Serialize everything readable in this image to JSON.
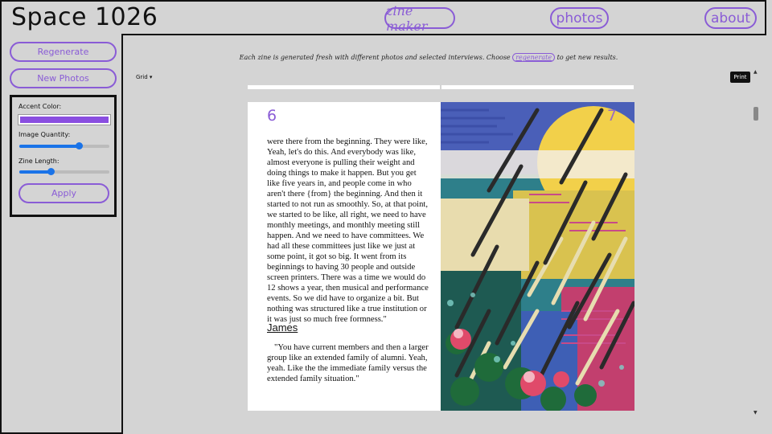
{
  "header": {
    "site_title": "Space 1026",
    "nav": [
      {
        "label": "zine maker"
      },
      {
        "label": "photos"
      },
      {
        "label": "about"
      }
    ]
  },
  "sidebar": {
    "regenerate_label": "Regenerate",
    "new_photos_label": "New Photos",
    "controls": {
      "accent_label": "Accent Color:",
      "accent_color": "#8a4ee0",
      "image_quantity_label": "Image Quantity:",
      "image_quantity_value": 0.66,
      "zine_length_label": "Zine Length:",
      "zine_length_value": 0.35,
      "apply_label": "Apply"
    }
  },
  "main": {
    "intro_before": "Each zine is generated fresh with different photos and selected interviews. Choose",
    "intro_link": "regenerate",
    "intro_after": "to get new results.",
    "view_select": "Grid ▾",
    "print_label": "Print"
  },
  "spread": {
    "left_page_number": "6",
    "right_page_number": "7",
    "body_text": "were there from the beginning. They were like, Yeah, let's do this. And everybody was like, almost everyone is pulling their weight and doing things to make it happen. But you get like five years in, and people come in who aren't there {from} the beginning. And then it started to not run as smoothly. So, at that point, we started to be like, all right, we need to have monthly meetings, and monthly meeting still happen. And we need to have committees. We had all these committees just like we just at some point, it got so big. It went from its beginnings to having 30 people and outside screen printers. There was a time we would do 12 shows a year, then musical and performance events. So we did have to organize a bit. But nothing was structured like a true institution or it was just so much free formness.\"",
    "speaker": "James",
    "quote": "\"You have current members and then a larger group like an extended family of alumni. Yeah, yeah. Like the the immediate family versus the extended family situation.\""
  },
  "icons": {
    "scroll_up": "scroll-up-arrow-icon",
    "scroll_down": "scroll-down-arrow-icon",
    "dropdown": "chevron-down-icon"
  }
}
